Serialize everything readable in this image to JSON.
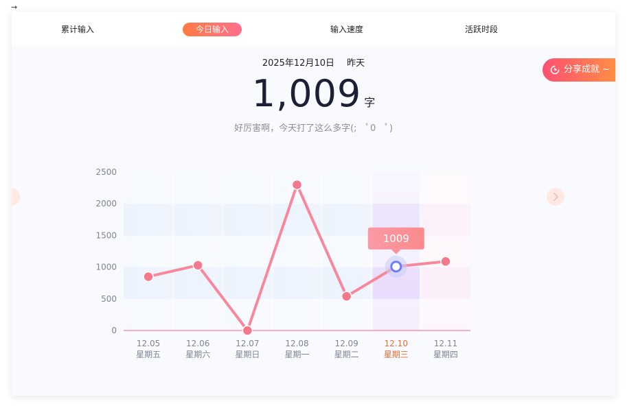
{
  "tabs": [
    {
      "label": "累计输入",
      "active": false
    },
    {
      "label": "今日输入",
      "active": true
    },
    {
      "label": "输入速度",
      "active": false
    },
    {
      "label": "活跃时段",
      "active": false
    }
  ],
  "header": {
    "date": "2025年12月10日",
    "yesterday_label": "昨天",
    "count": "1,009",
    "unit": "字",
    "message": "好厉害啊，今天打了这么多字(;　ﾟ0　ﾟ)"
  },
  "share_button": {
    "label": "分享成就 ~",
    "icon": "share-refresh-icon"
  },
  "nav": {
    "prev_icon": "chevron-left-icon",
    "next_icon": "chevron-right-icon"
  },
  "colors": {
    "accent": "#ff6f8d",
    "line": "#f7889b",
    "highlight_text": "#f06a2e",
    "point_selected": "#6b7dff"
  },
  "chart_data": {
    "type": "line",
    "categories": [
      "12.05",
      "12.06",
      "12.07",
      "12.08",
      "12.09",
      "12.10",
      "12.11"
    ],
    "weekdays": [
      "星期五",
      "星期六",
      "星期日",
      "星期一",
      "星期二",
      "星期三",
      "星期四"
    ],
    "values": [
      850,
      1030,
      0,
      2300,
      540,
      1009,
      1090
    ],
    "ylim": [
      0,
      2500
    ],
    "yticks": [
      0,
      500,
      1000,
      1500,
      2000,
      2500
    ],
    "highlight_index": 5,
    "tooltip": "1009",
    "grid": true
  }
}
